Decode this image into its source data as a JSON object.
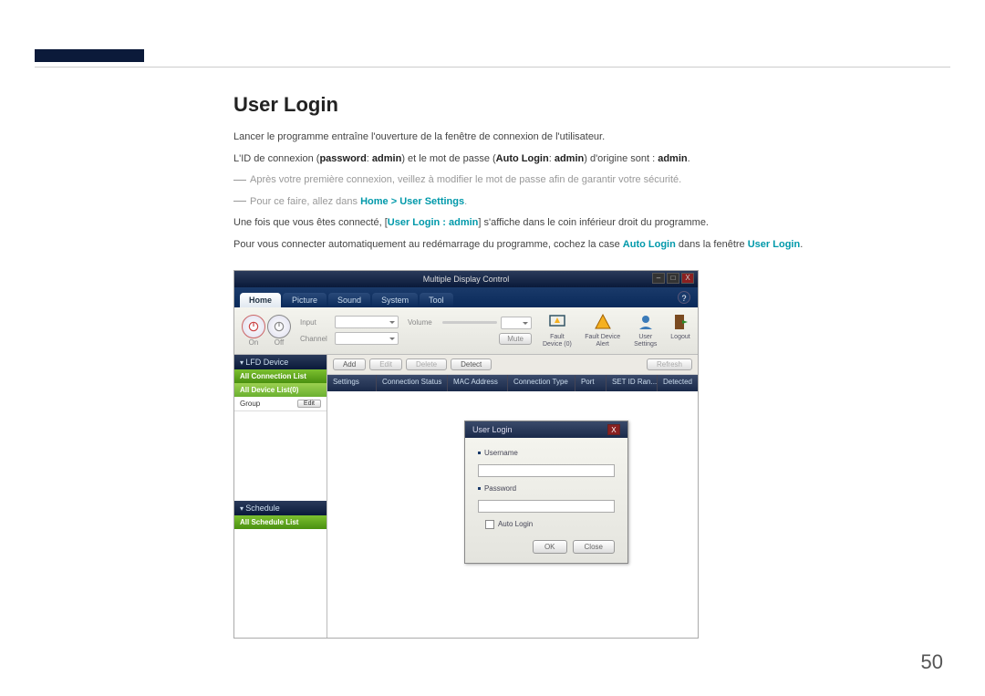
{
  "page": {
    "number": "50",
    "heading": "User Login",
    "p1": "Lancer le programme entraîne l'ouverture de la fenêtre de connexion de l'utilisateur.",
    "p2_a": "L'ID de connexion (",
    "p2_b": "password",
    "p2_c": ": ",
    "p2_d": "admin",
    "p2_e": ") et le mot de passe (",
    "p2_f": "Auto Login",
    "p2_g": ": ",
    "p2_h": "admin",
    "p2_i": ") d'origine sont : ",
    "p2_j": "admin",
    "p2_k": ".",
    "note1": "Après votre première connexion, veillez à modifier le mot de passe afin de garantir votre sécurité.",
    "note2_a": "Pour ce faire, allez dans ",
    "note2_b": "Home",
    "note2_c": " > ",
    "note2_d": "User Settings",
    "note2_e": ".",
    "p3_a": "Une fois que vous êtes connecté, [",
    "p3_b": "User Login : admin",
    "p3_c": "] s'affiche dans le coin inférieur droit du programme.",
    "p4_a": "Pour vous connecter automatiquement au redémarrage du programme, cochez la case ",
    "p4_b": "Auto Login",
    "p4_c": " dans la fenêtre ",
    "p4_d": "User Login",
    "p4_e": "."
  },
  "app": {
    "title": "Multiple Display Control",
    "tabs": [
      "Home",
      "Picture",
      "Sound",
      "System",
      "Tool"
    ],
    "active_tab": 0,
    "onoff": {
      "on": "On",
      "off": "Off"
    },
    "fields": {
      "input": "Input",
      "channel": "Channel",
      "volume": "Volume",
      "mute": "Mute"
    },
    "icons": {
      "faultDevice": "Fault Device\n(0)",
      "faultAlert": "Fault Device\nAlert",
      "userSettings": "User Settings",
      "logout": "Logout"
    },
    "sidebar": {
      "lfd": "LFD Device",
      "allConn": "All Connection List",
      "allDev": "All Device List(0)",
      "group": "Group",
      "edit": "Edit",
      "schedule": "Schedule",
      "allSched": "All Schedule List"
    },
    "actions": {
      "add": "Add",
      "edit": "Edit",
      "delete": "Delete",
      "detect": "Detect",
      "refresh": "Refresh"
    },
    "columns": [
      "Settings",
      "Connection Status",
      "MAC Address",
      "Connection Type",
      "Port",
      "SET ID Ran...",
      "Detected"
    ],
    "dialog": {
      "title": "User Login",
      "username": "Username",
      "password": "Password",
      "auto": "Auto Login",
      "ok": "OK",
      "close": "Close"
    }
  }
}
